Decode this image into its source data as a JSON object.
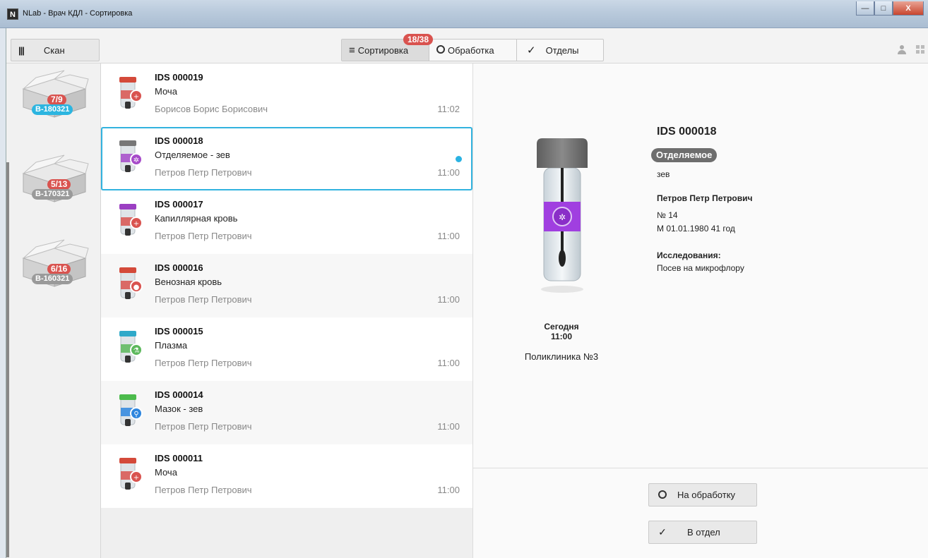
{
  "window": {
    "app_icon": "N",
    "title": "NLab - Врач КДЛ - Сортировка",
    "controls": {
      "minimize": "—",
      "maximize": "□",
      "close": "X"
    }
  },
  "toolbar": {
    "scan": {
      "icon": "barcode-icon",
      "label": "Скан"
    },
    "count_badge": "18/38",
    "tabs": [
      {
        "icon": "≡",
        "label": "Сортировка",
        "active": true
      },
      {
        "icon": "○",
        "label": "Обработка",
        "active": false
      },
      {
        "icon": "✓",
        "label": "Отделы",
        "active": false
      }
    ],
    "right_icons": [
      "user-icon",
      "grid-icon"
    ]
  },
  "boxes": [
    {
      "count": "7/9",
      "code": "B-180321",
      "active": true
    },
    {
      "count": "5/13",
      "code": "B-170321",
      "active": false
    },
    {
      "count": "6/16",
      "code": "B-160321",
      "active": false
    }
  ],
  "samples": [
    {
      "id": "IDS 000019",
      "material": "Моча",
      "patient": "Борисов Борис Борисович",
      "time": "11:02",
      "cap_color": "#d44a3a",
      "label_color": "#d9534f",
      "symbol": "+"
    },
    {
      "id": "IDS 000018",
      "material": "Отделяемое - зев",
      "patient": "Петров Петр Петрович",
      "time": "11:00",
      "cap_color": "#777777",
      "label_color": "#a64ac9",
      "symbol": "✲",
      "selected": true,
      "unread": true
    },
    {
      "id": "IDS 000017",
      "material": "Капиллярная кровь",
      "patient": "Петров Петр Петрович",
      "time": "11:00",
      "cap_color": "#9b3fc2",
      "label_color": "#d9534f",
      "symbol": "+"
    },
    {
      "id": "IDS 000016",
      "material": "Венозная кровь",
      "patient": "Петров Петр Петрович",
      "time": "11:00",
      "cap_color": "#d44a3a",
      "label_color": "#d9534f",
      "symbol": "●"
    },
    {
      "id": "IDS 000015",
      "material": "Плазма",
      "patient": "Петров Петр Петрович",
      "time": "11:00",
      "cap_color": "#2fa9c9",
      "label_color": "#5cb85c",
      "symbol": "⚗"
    },
    {
      "id": "IDS 000014",
      "material": "Мазок - зев",
      "patient": "Петров Петр Петрович",
      "time": "11:00",
      "cap_color": "#4cbb4c",
      "label_color": "#2e86de",
      "symbol": "⚲"
    },
    {
      "id": "IDS 000011",
      "material": "Моча",
      "patient": "Петров Петр Петрович",
      "time": "11:00",
      "cap_color": "#d44a3a",
      "label_color": "#d9534f",
      "symbol": "+"
    }
  ],
  "detail": {
    "id": "IDS 000018",
    "material_chip": "Отделяемое",
    "material_sub": "зев",
    "patient": "Петров Петр Петрович",
    "number": "№ 14",
    "birth": "М 01.01.1980 41 год",
    "research_title": "Исследования:",
    "research": "Посев на микрофлору",
    "date": "Сегодня",
    "time": "11:00",
    "clinic": "Поликлиника №3",
    "actions": [
      {
        "icon": "○",
        "label": "На обработку"
      },
      {
        "icon": "✓",
        "label": "В отдел"
      }
    ]
  }
}
